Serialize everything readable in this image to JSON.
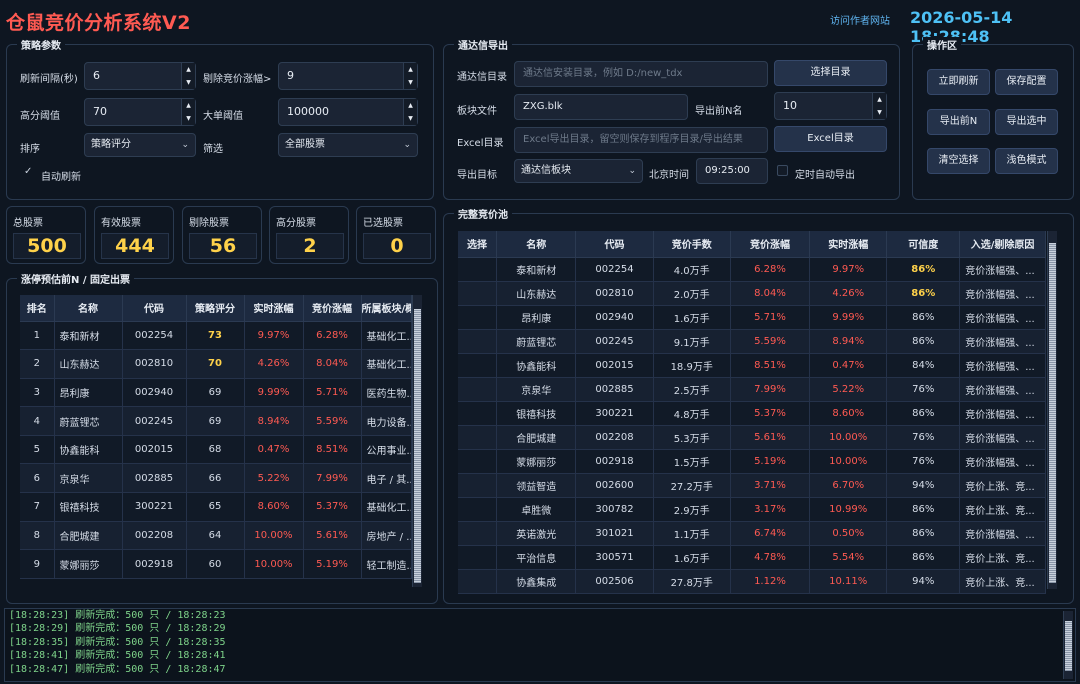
{
  "app": {
    "title": "仓鼠竞价分析系统V2",
    "author_link": "访问作者网站",
    "clock": "2026-05-14 18:28:48"
  },
  "strategy": {
    "title": "策略参数",
    "refresh_label": "刷新间隔(秒)",
    "refresh_value": "6",
    "exclude_label": "剔除竞价涨幅>",
    "exclude_value": "9",
    "high_label": "高分阈值",
    "high_value": "70",
    "big_label": "大单阈值",
    "big_value": "100000",
    "sort_label": "排序",
    "sort_value": "策略评分",
    "filter_label": "筛选",
    "filter_value": "全部股票",
    "auto_refresh": "自动刷新"
  },
  "tdx": {
    "title": "通达信导出",
    "dir_label": "通达信目录",
    "dir_placeholder": "通达信安装目录，例如 D:/new_tdx",
    "choose_dir": "选择目录",
    "block_label": "板块文件",
    "block_value": "ZXG.blk",
    "topn_label": "导出前N名",
    "topn_value": "10",
    "excel_label": "Excel目录",
    "excel_placeholder": "Excel导出目录，留空则保存到程序目录/导出结果",
    "excel_btn": "Excel目录",
    "target_label": "导出目标",
    "target_value": "通达信板块",
    "bj_label": "北京时间",
    "time_value": "09:25:00",
    "timer_label": "定时自动导出"
  },
  "ops": {
    "title": "操作区",
    "refresh_now": "立即刷新",
    "save_config": "保存配置",
    "export_topn": "导出前N",
    "export_selected": "导出选中",
    "clear_selection": "清空选择",
    "light_mode": "浅色模式"
  },
  "stats": [
    {
      "label": "总股票",
      "value": "500"
    },
    {
      "label": "有效股票",
      "value": "444"
    },
    {
      "label": "剔除股票",
      "value": "56"
    },
    {
      "label": "高分股票",
      "value": "2"
    },
    {
      "label": "已选股票",
      "value": "0"
    }
  ],
  "limit_table": {
    "title": "涨停预估前N / 固定出票",
    "headers": [
      "排名",
      "名称",
      "代码",
      "策略评分",
      "实时涨幅",
      "竞价涨幅",
      "所属板块/概"
    ],
    "rows": [
      [
        "1",
        "泰和新材",
        "002254",
        "73",
        "9.97%",
        "6.28%",
        "基础化工..."
      ],
      [
        "2",
        "山东赫达",
        "002810",
        "70",
        "4.26%",
        "8.04%",
        "基础化工..."
      ],
      [
        "3",
        "昂利康",
        "002940",
        "69",
        "9.99%",
        "5.71%",
        "医药生物..."
      ],
      [
        "4",
        "蔚蓝锂芯",
        "002245",
        "69",
        "8.94%",
        "5.59%",
        "电力设备..."
      ],
      [
        "5",
        "协鑫能科",
        "002015",
        "68",
        "0.47%",
        "8.51%",
        "公用事业..."
      ],
      [
        "6",
        "京泉华",
        "002885",
        "66",
        "5.22%",
        "7.99%",
        "电子 / 其..."
      ],
      [
        "7",
        "银禧科技",
        "300221",
        "65",
        "8.60%",
        "5.37%",
        "基础化工..."
      ],
      [
        "8",
        "合肥城建",
        "002208",
        "64",
        "10.00%",
        "5.61%",
        "房地产 / ..."
      ],
      [
        "9",
        "蒙娜丽莎",
        "002918",
        "60",
        "10.00%",
        "5.19%",
        "轻工制造..."
      ]
    ]
  },
  "pool_table": {
    "title": "完整竞价池",
    "headers": [
      "选择",
      "名称",
      "代码",
      "竞价手数",
      "竞价涨幅",
      "实时涨幅",
      "可信度",
      "入选/剔除原因"
    ],
    "rows": [
      [
        "",
        "泰和新材",
        "002254",
        "4.0万手",
        "6.28%",
        "9.97%",
        "86%",
        "竞价涨幅强、..."
      ],
      [
        "",
        "山东赫达",
        "002810",
        "2.0万手",
        "8.04%",
        "4.26%",
        "86%",
        "竞价涨幅强、..."
      ],
      [
        "",
        "昂利康",
        "002940",
        "1.6万手",
        "5.71%",
        "9.99%",
        "86%",
        "竞价涨幅强、..."
      ],
      [
        "",
        "蔚蓝锂芯",
        "002245",
        "9.1万手",
        "5.59%",
        "8.94%",
        "86%",
        "竞价涨幅强、..."
      ],
      [
        "",
        "协鑫能科",
        "002015",
        "18.9万手",
        "8.51%",
        "0.47%",
        "84%",
        "竞价涨幅强、..."
      ],
      [
        "",
        "京泉华",
        "002885",
        "2.5万手",
        "7.99%",
        "5.22%",
        "76%",
        "竞价涨幅强、..."
      ],
      [
        "",
        "银禧科技",
        "300221",
        "4.8万手",
        "5.37%",
        "8.60%",
        "86%",
        "竞价涨幅强、..."
      ],
      [
        "",
        "合肥城建",
        "002208",
        "5.3万手",
        "5.61%",
        "10.00%",
        "76%",
        "竞价涨幅强、..."
      ],
      [
        "",
        "蒙娜丽莎",
        "002918",
        "1.5万手",
        "5.19%",
        "10.00%",
        "76%",
        "竞价涨幅强、..."
      ],
      [
        "",
        "领益智造",
        "002600",
        "27.2万手",
        "3.71%",
        "6.70%",
        "94%",
        "竞价上涨、竞..."
      ],
      [
        "",
        "卓胜微",
        "300782",
        "2.9万手",
        "3.17%",
        "10.99%",
        "86%",
        "竞价上涨、竞..."
      ],
      [
        "",
        "英诺激光",
        "301021",
        "1.1万手",
        "6.74%",
        "0.50%",
        "86%",
        "竞价涨幅强、..."
      ],
      [
        "",
        "平治信息",
        "300571",
        "1.6万手",
        "4.78%",
        "5.54%",
        "86%",
        "竞价上涨、竞..."
      ],
      [
        "",
        "协鑫集成",
        "002506",
        "27.8万手",
        "1.12%",
        "10.11%",
        "94%",
        "竞价上涨、竞..."
      ]
    ]
  },
  "log": [
    "[18:28:23] 刷新完成：500 只 / 18:28:23",
    "[18:28:29] 刷新完成：500 只 / 18:28:29",
    "[18:28:35] 刷新完成：500 只 / 18:28:35",
    "[18:28:41] 刷新完成：500 只 / 18:28:41",
    "[18:28:47] 刷新完成：500 只 / 18:28:47"
  ]
}
